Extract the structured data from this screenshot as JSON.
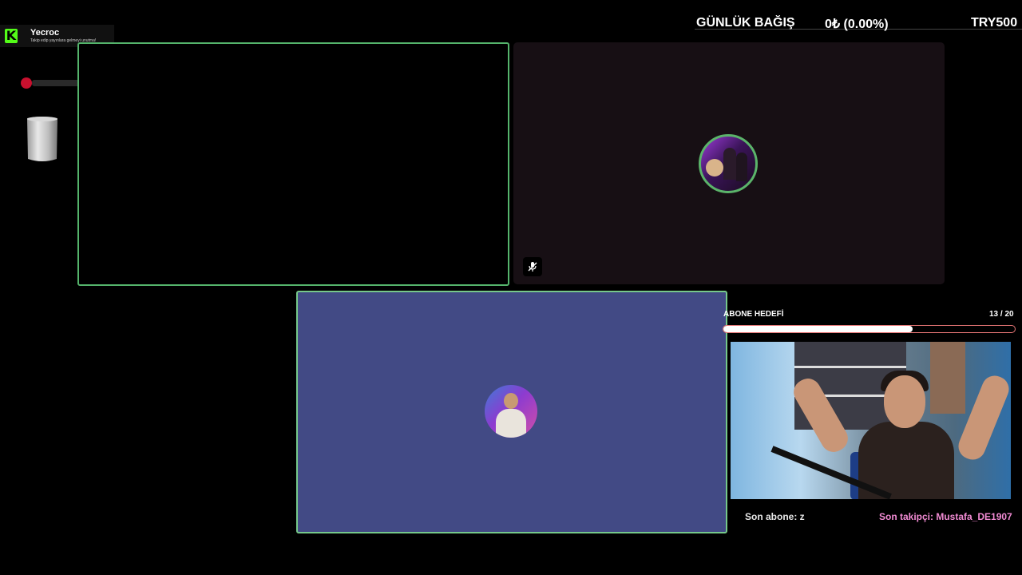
{
  "kick_alert": {
    "name": "Yecroc",
    "subtitle": "Takip edip yayınlara gelmeyi unutma!"
  },
  "donation": {
    "label": "GÜNLÜK BAĞIŞ",
    "amount": "0₺ (0.00%)",
    "goal": "TRY500"
  },
  "participants": {
    "tile_1": {
      "state": "video-off",
      "border_color": "#55b46c"
    },
    "tile_2": {
      "state": "avatar",
      "muted_icon": "mic-off-icon",
      "background": "#170f14"
    },
    "tile_3": {
      "state": "avatar",
      "background": "#424a85"
    }
  },
  "sub_goal": {
    "label": "ABONE HEDEFİ",
    "count": "13 / 20",
    "progress": 0.65
  },
  "footer": {
    "son_abone": "Son abone: z",
    "son_takipci": "Son takipçi: Mustafa_DE1907"
  },
  "colors": {
    "kick_green": "#53fc18",
    "tile_border": "#55b46c",
    "follower_pink": "#f08ad2"
  }
}
